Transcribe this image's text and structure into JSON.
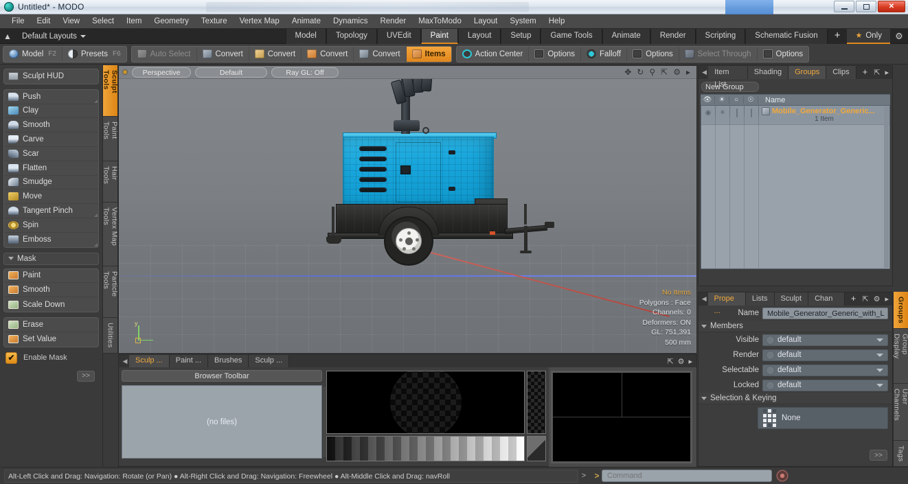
{
  "window": {
    "title": "Untitled* - MODO",
    "minimize_label": "minimize",
    "maximize_label": "restore",
    "close_label": "✕"
  },
  "menubar": {
    "items": [
      "File",
      "Edit",
      "View",
      "Select",
      "Item",
      "Geometry",
      "Texture",
      "Vertex Map",
      "Animate",
      "Dynamics",
      "Render",
      "MaxToModo",
      "Layout",
      "System",
      "Help"
    ]
  },
  "layoutbar": {
    "up_icon": "eject-icon",
    "layouts_label": "Default Layouts",
    "tabs": [
      {
        "label": "Model",
        "active": false
      },
      {
        "label": "Topology",
        "active": false
      },
      {
        "label": "UVEdit",
        "active": false
      },
      {
        "label": "Paint",
        "active": true
      },
      {
        "label": "Layout",
        "active": false
      },
      {
        "label": "Setup",
        "active": false
      },
      {
        "label": "Game Tools",
        "active": false
      },
      {
        "label": "Animate",
        "active": false
      },
      {
        "label": "Render",
        "active": false
      },
      {
        "label": "Scripting",
        "active": false
      },
      {
        "label": "Schematic Fusion",
        "active": false
      }
    ],
    "add_tab_label": "+",
    "only_label": "Only",
    "star_glyph": "★"
  },
  "modebar": {
    "left_group": [
      {
        "label": "Model",
        "hotkey": "F2",
        "icon": "sphere-icon",
        "state": "normal"
      },
      {
        "label": "Presets",
        "hotkey": "F6",
        "icon": "half-sphere-icon",
        "state": "normal"
      }
    ],
    "convert_group": [
      {
        "label": "Auto Select",
        "icon": "cube-gray-icon",
        "state": "dim"
      },
      {
        "label": "Convert",
        "icon": "cube-blue-icon",
        "state": "normal"
      },
      {
        "label": "Convert",
        "icon": "cube-yellow-icon",
        "state": "normal"
      },
      {
        "label": "Convert",
        "icon": "cube-orange-icon",
        "state": "normal"
      },
      {
        "label": "Convert",
        "icon": "cube-blue2-icon",
        "state": "normal"
      },
      {
        "label": "Items",
        "icon": "cube-items-icon",
        "state": "active"
      }
    ],
    "right_group": [
      {
        "label": "Action Center",
        "icon": "action-center-icon",
        "state": "normal"
      },
      {
        "label": "Options",
        "icon": "checkbox-icon",
        "state": "normal"
      },
      {
        "label": "Falloff",
        "icon": "falloff-icon",
        "state": "normal"
      },
      {
        "label": "Options",
        "icon": "checkbox-icon",
        "state": "normal"
      },
      {
        "label": "Select Through",
        "icon": "select-through-icon",
        "state": "dim"
      },
      {
        "label": "Options",
        "icon": "checkbox-icon",
        "state": "normal"
      }
    ]
  },
  "left_panel": {
    "hud_label": "Sculpt HUD",
    "hud_icon": "hud-icon",
    "sculpt_tools": [
      {
        "label": "Push",
        "icon": "push-icon",
        "has_corner": true
      },
      {
        "label": "Clay",
        "icon": "clay-icon",
        "has_corner": false
      },
      {
        "label": "Smooth",
        "icon": "smooth-icon",
        "has_corner": false
      },
      {
        "label": "Carve",
        "icon": "carve-icon",
        "has_corner": false
      },
      {
        "label": "Scar",
        "icon": "scar-icon",
        "has_corner": false
      },
      {
        "label": "Flatten",
        "icon": "flatten-icon",
        "has_corner": false
      },
      {
        "label": "Smudge",
        "icon": "smudge-icon",
        "has_corner": false
      },
      {
        "label": "Move",
        "icon": "move-icon",
        "has_corner": false
      },
      {
        "label": "Tangent Pinch",
        "icon": "pinch-icon",
        "has_corner": true
      },
      {
        "label": "Spin",
        "icon": "spin-icon",
        "has_corner": false
      },
      {
        "label": "Emboss",
        "icon": "emboss-icon",
        "has_corner": true
      }
    ],
    "mask_header": "Mask",
    "mask_tools": [
      {
        "label": "Paint",
        "icon": "mask-paint-icon"
      },
      {
        "label": "Smooth",
        "icon": "mask-smooth-icon"
      },
      {
        "label": "Scale Down",
        "icon": "mask-scale-icon"
      }
    ],
    "mask_tools2": [
      {
        "label": "Erase",
        "icon": "mask-erase-icon"
      },
      {
        "label": "Set Value",
        "icon": "mask-setvalue-icon"
      }
    ],
    "enable_mask_label": "Enable Mask",
    "enable_mask_checked": true,
    "more_label": ">>",
    "vertical_tabs": [
      {
        "label": "Sculpt Tools",
        "active": true
      },
      {
        "label": "Paint Tools",
        "active": false
      },
      {
        "label": "Hair Tools",
        "active": false
      },
      {
        "label": "Vertex Map Tools",
        "active": false
      },
      {
        "label": "Particle Tools",
        "active": false
      },
      {
        "label": "Utilities",
        "active": false
      }
    ]
  },
  "viewport": {
    "view_mode": "Perspective",
    "shading_mode": "Default",
    "raygl_label": "Ray GL: Off",
    "nav_icons": [
      "pan-icon",
      "rotate-icon",
      "zoom-icon",
      "fit-icon",
      "gear-icon",
      "chevron-right-icon"
    ],
    "axis_label": "y",
    "info": {
      "selection": "No Items",
      "polygons": "Polygons : Face",
      "channels": "Channels: 0",
      "deformers": "Deformers: ON",
      "gl": "GL: 751,391",
      "scale": "500 mm"
    }
  },
  "browser": {
    "tabs": [
      {
        "label": "Sculp ...",
        "active": true
      },
      {
        "label": "Paint ...",
        "active": false
      },
      {
        "label": "Brushes",
        "active": false
      },
      {
        "label": "Sculp ...",
        "active": false
      }
    ],
    "toolbar_label": "Browser Toolbar",
    "empty_label": "(no files)"
  },
  "groups_panel": {
    "tabs": [
      {
        "label": "Item List",
        "active": false
      },
      {
        "label": "Shading",
        "active": false
      },
      {
        "label": "Groups",
        "active": true
      },
      {
        "label": "Clips",
        "active": false
      }
    ],
    "add_tab_label": "+",
    "new_group_label": "New Group",
    "columns": [
      "eye-icon",
      "render-icon",
      "select-icon",
      "lock-icon"
    ],
    "name_column": "Name",
    "rows": [
      {
        "name": "Mobile_Generator_Generic...",
        "subtitle": "1 Item",
        "icon": "group-icon"
      }
    ]
  },
  "properties_panel": {
    "tabs": [
      {
        "label": "Prope ...",
        "active": true
      },
      {
        "label": "Lists",
        "active": false
      },
      {
        "label": "Sculpt",
        "active": false
      },
      {
        "label": "Chan ...",
        "active": false
      }
    ],
    "add_tab_label": "+",
    "name_label": "Name",
    "name_value": "Mobile_Generator_Generic_with_L",
    "members_header": "Members",
    "fields": [
      {
        "label": "Visible",
        "value": "default"
      },
      {
        "label": "Render",
        "value": "default"
      },
      {
        "label": "Selectable",
        "value": "default"
      },
      {
        "label": "Locked",
        "value": "default"
      }
    ],
    "selection_header": "Selection & Keying",
    "keying_value": "None",
    "more_label": ">>",
    "vertical_tabs": [
      {
        "label": "Groups",
        "active": true
      },
      {
        "label": "Group Display",
        "active": false
      },
      {
        "label": "User Channels",
        "active": false
      },
      {
        "label": "Tags",
        "active": false
      }
    ]
  },
  "statusbar": {
    "hint": "Alt-Left Click and Drag: Navigation: Rotate (or Pan) ● Alt-Right Click and Drag: Navigation: Freewheel ● Alt-Middle Click and Drag: navRoll",
    "expand_glyph": ">",
    "command_prompt": ">",
    "command_placeholder": "Command",
    "record_icon": "record-icon"
  },
  "colors": {
    "accent": "#f0a93c",
    "model_blue": "#18a6dc",
    "panel_bg": "#3a3a3a",
    "viewport_bg": "#7a7e82"
  }
}
